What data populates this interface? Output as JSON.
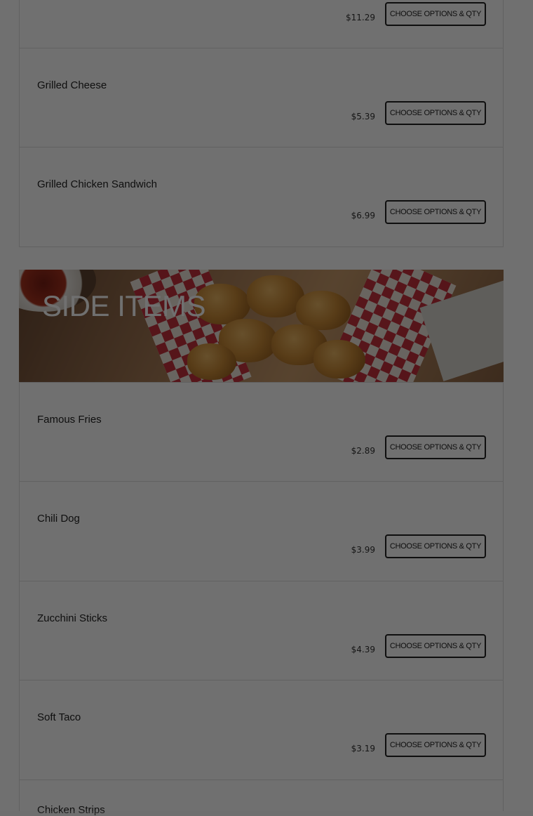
{
  "button_label": "CHOOSE OPTIONS & QTY",
  "top_items": [
    {
      "name": "",
      "price": "$11.29"
    },
    {
      "name": "Grilled Cheese",
      "price": "$5.39"
    },
    {
      "name": "Grilled Chicken Sandwich",
      "price": "$6.99"
    }
  ],
  "section": {
    "title": "SIDE ITEMS",
    "image": "fried-chicken-nuggets-basket-photo"
  },
  "side_items": [
    {
      "name": "Famous Fries",
      "price": "$2.89"
    },
    {
      "name": "Chili Dog",
      "price": "$3.99"
    },
    {
      "name": "Zucchini Sticks",
      "price": "$4.39"
    },
    {
      "name": "Soft Taco",
      "price": "$3.19"
    },
    {
      "name": "Chicken Strips",
      "price": ""
    }
  ],
  "overlay": {
    "color": "#000000",
    "opacity": 0.56
  }
}
